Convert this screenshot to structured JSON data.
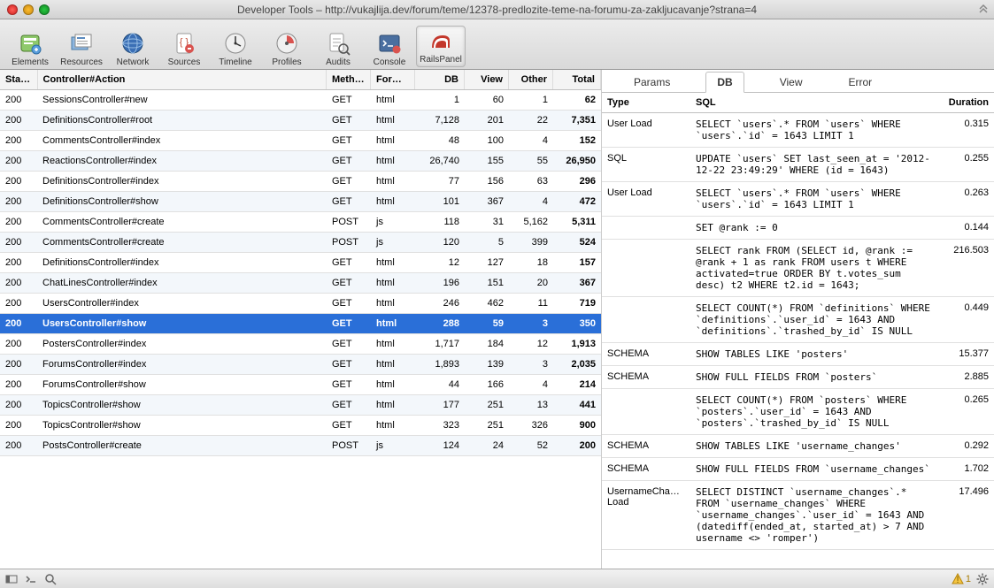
{
  "window_title": "Developer Tools – http://vukajlija.dev/forum/teme/12378-predlozite-teme-na-forumu-za-zakljucavanje?strana=4",
  "toolbar": [
    {
      "id": "elements",
      "label": "Elements"
    },
    {
      "id": "resources",
      "label": "Resources"
    },
    {
      "id": "network",
      "label": "Network"
    },
    {
      "id": "sources",
      "label": "Sources"
    },
    {
      "id": "timeline",
      "label": "Timeline"
    },
    {
      "id": "profiles",
      "label": "Profiles"
    },
    {
      "id": "audits",
      "label": "Audits"
    },
    {
      "id": "console",
      "label": "Console"
    },
    {
      "id": "railspanel",
      "label": "RailsPanel"
    }
  ],
  "requests_columns": [
    "Status",
    "Controller#Action",
    "Method",
    "Format",
    "DB",
    "View",
    "Other",
    "Total"
  ],
  "requests": [
    {
      "status": "200",
      "ca": "SessionsController#new",
      "method": "GET",
      "format": "html",
      "db": "1",
      "view": "60",
      "other": "1",
      "total": "62"
    },
    {
      "status": "200",
      "ca": "DefinitionsController#root",
      "method": "GET",
      "format": "html",
      "db": "7,128",
      "view": "201",
      "other": "22",
      "total": "7,351"
    },
    {
      "status": "200",
      "ca": "CommentsController#index",
      "method": "GET",
      "format": "html",
      "db": "48",
      "view": "100",
      "other": "4",
      "total": "152"
    },
    {
      "status": "200",
      "ca": "ReactionsController#index",
      "method": "GET",
      "format": "html",
      "db": "26,740",
      "view": "155",
      "other": "55",
      "total": "26,950"
    },
    {
      "status": "200",
      "ca": "DefinitionsController#index",
      "method": "GET",
      "format": "html",
      "db": "77",
      "view": "156",
      "other": "63",
      "total": "296"
    },
    {
      "status": "200",
      "ca": "DefinitionsController#show",
      "method": "GET",
      "format": "html",
      "db": "101",
      "view": "367",
      "other": "4",
      "total": "472"
    },
    {
      "status": "200",
      "ca": "CommentsController#create",
      "method": "POST",
      "format": "js",
      "db": "118",
      "view": "31",
      "other": "5,162",
      "total": "5,311"
    },
    {
      "status": "200",
      "ca": "CommentsController#create",
      "method": "POST",
      "format": "js",
      "db": "120",
      "view": "5",
      "other": "399",
      "total": "524"
    },
    {
      "status": "200",
      "ca": "DefinitionsController#index",
      "method": "GET",
      "format": "html",
      "db": "12",
      "view": "127",
      "other": "18",
      "total": "157"
    },
    {
      "status": "200",
      "ca": "ChatLinesController#index",
      "method": "GET",
      "format": "html",
      "db": "196",
      "view": "151",
      "other": "20",
      "total": "367"
    },
    {
      "status": "200",
      "ca": "UsersController#index",
      "method": "GET",
      "format": "html",
      "db": "246",
      "view": "462",
      "other": "11",
      "total": "719"
    },
    {
      "status": "200",
      "ca": "UsersController#show",
      "method": "GET",
      "format": "html",
      "db": "288",
      "view": "59",
      "other": "3",
      "total": "350",
      "selected": true
    },
    {
      "status": "200",
      "ca": "PostersController#index",
      "method": "GET",
      "format": "html",
      "db": "1,717",
      "view": "184",
      "other": "12",
      "total": "1,913"
    },
    {
      "status": "200",
      "ca": "ForumsController#index",
      "method": "GET",
      "format": "html",
      "db": "1,893",
      "view": "139",
      "other": "3",
      "total": "2,035"
    },
    {
      "status": "200",
      "ca": "ForumsController#show",
      "method": "GET",
      "format": "html",
      "db": "44",
      "view": "166",
      "other": "4",
      "total": "214"
    },
    {
      "status": "200",
      "ca": "TopicsController#show",
      "method": "GET",
      "format": "html",
      "db": "177",
      "view": "251",
      "other": "13",
      "total": "441"
    },
    {
      "status": "200",
      "ca": "TopicsController#show",
      "method": "GET",
      "format": "html",
      "db": "323",
      "view": "251",
      "other": "326",
      "total": "900"
    },
    {
      "status": "200",
      "ca": "PostsController#create",
      "method": "POST",
      "format": "js",
      "db": "124",
      "view": "24",
      "other": "52",
      "total": "200"
    }
  ],
  "right_tabs": [
    "Params",
    "DB",
    "View",
    "Error"
  ],
  "right_active_tab": 1,
  "db_columns": [
    "Type",
    "SQL",
    "Duration"
  ],
  "db_rows": [
    {
      "type": "User Load",
      "sql": "SELECT `users`.* FROM `users` WHERE `users`.`id` = 1643 LIMIT 1",
      "dur": "0.315"
    },
    {
      "type": "SQL",
      "sql": "UPDATE `users` SET last_seen_at = '2012-12-22 23:49:29' WHERE (id = 1643)",
      "dur": "0.255"
    },
    {
      "type": "User Load",
      "sql": "SELECT `users`.* FROM `users` WHERE `users`.`id` = 1643 LIMIT 1",
      "dur": "0.263"
    },
    {
      "type": "",
      "sql": "SET @rank := 0",
      "dur": "0.144"
    },
    {
      "type": "",
      "sql": "SELECT rank FROM (SELECT id, @rank := @rank + 1 as rank FROM users t WHERE activated=true ORDER BY t.votes_sum desc) t2 WHERE t2.id = 1643;",
      "dur": "216.503"
    },
    {
      "type": "",
      "sql": "SELECT COUNT(*) FROM `definitions` WHERE `definitions`.`user_id` = 1643 AND `definitions`.`trashed_by_id` IS NULL",
      "dur": "0.449"
    },
    {
      "type": "SCHEMA",
      "sql": "SHOW TABLES LIKE 'posters'",
      "dur": "15.377"
    },
    {
      "type": "SCHEMA",
      "sql": "SHOW FULL FIELDS FROM `posters`",
      "dur": "2.885"
    },
    {
      "type": "",
      "sql": "SELECT COUNT(*) FROM `posters` WHERE `posters`.`user_id` = 1643 AND `posters`.`trashed_by_id` IS NULL",
      "dur": "0.265"
    },
    {
      "type": "SCHEMA",
      "sql": "SHOW TABLES LIKE 'username_changes'",
      "dur": "0.292"
    },
    {
      "type": "SCHEMA",
      "sql": "SHOW FULL FIELDS FROM `username_changes`",
      "dur": "1.702"
    },
    {
      "type": "UsernameChange Load",
      "sql": "SELECT DISTINCT `username_changes`.* FROM `username_changes` WHERE `username_changes`.`user_id` = 1643 AND (datediff(ended_at, started_at) > 7 AND username <> 'romper')",
      "dur": "17.496"
    }
  ],
  "footer_warning_count": "1"
}
